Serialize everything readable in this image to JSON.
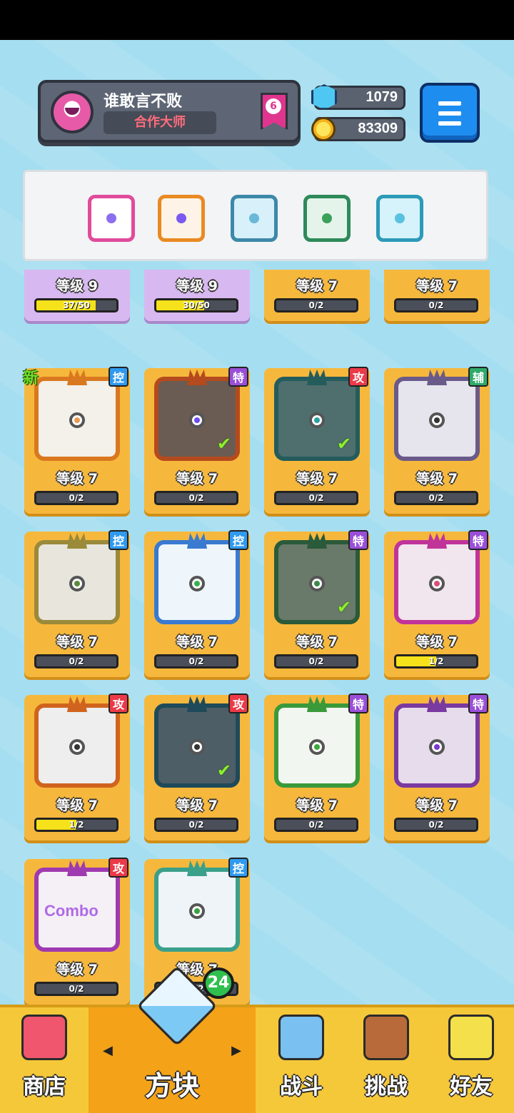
{
  "header": {
    "player_name": "谁敢言不败",
    "player_title": "合作大师",
    "rank": "6",
    "gems": "1079",
    "coins": "83309"
  },
  "deck": [
    {
      "frame": "#e04b9b",
      "inner": "#ffffff",
      "pip": "#8c6ff0"
    },
    {
      "frame": "#e98a22",
      "inner": "#fdf3e6",
      "pip": "#7a5af0"
    },
    {
      "frame": "#3d88a8",
      "inner": "#d8f0fa",
      "pip": "#6ab8d8"
    },
    {
      "frame": "#2e8a5a",
      "inner": "#e4f4ea",
      "pip": "#3aa05a"
    },
    {
      "frame": "#2c9ab8",
      "inner": "#d6f2fa",
      "pip": "#58c2e0"
    }
  ],
  "cards_partial": [
    {
      "level": "等级 9",
      "progress": "37/50",
      "fill": 0.74,
      "purple": true
    },
    {
      "level": "等级 9",
      "progress": "30/50",
      "fill": 0.6,
      "purple": true
    },
    {
      "level": "等级 7",
      "progress": "0/2",
      "fill": 0,
      "purple": false
    },
    {
      "level": "等级 7",
      "progress": "0/2",
      "fill": 0,
      "purple": false
    }
  ],
  "cards": [
    {
      "tag": "控",
      "tagType": "ctrl",
      "level": "等级 7",
      "progress": "0/2",
      "fill": 0,
      "frame": "#d9781f",
      "inner": "#f4f0ea",
      "pip": "#e89a50",
      "new": "新",
      "check": false
    },
    {
      "tag": "特",
      "tagType": "spec",
      "level": "等级 7",
      "progress": "0/2",
      "fill": 0,
      "frame": "#b44a1e",
      "inner": "#6a5c52",
      "pip": "#6d4cf0",
      "check": true
    },
    {
      "tag": "攻",
      "tagType": "atk",
      "level": "等级 7",
      "progress": "0/2",
      "fill": 0,
      "frame": "#245c5c",
      "inner": "#4f6e6e",
      "pip": "#2aa0a0",
      "check": true
    },
    {
      "tag": "辅",
      "tagType": "sup",
      "level": "等级 7",
      "progress": "0/2",
      "fill": 0,
      "frame": "#6a5a8a",
      "inner": "#e6e4ec",
      "pip": "#333333",
      "check": false
    },
    {
      "tag": "控",
      "tagType": "ctrl",
      "level": "等级 7",
      "progress": "0/2",
      "fill": 0,
      "frame": "#9a8a3a",
      "inner": "#e8e6dc",
      "pip": "#5a8a3a",
      "check": false
    },
    {
      "tag": "控",
      "tagType": "ctrl",
      "level": "等级 7",
      "progress": "0/2",
      "fill": 0,
      "frame": "#3a7ad0",
      "inner": "#eef6fc",
      "pip": "#3ab050",
      "check": false
    },
    {
      "tag": "特",
      "tagType": "spec",
      "level": "等级 7",
      "progress": "0/2",
      "fill": 0,
      "frame": "#2a5a3a",
      "inner": "#6a7a6a",
      "pip": "#3a8a4a",
      "check": true
    },
    {
      "tag": "特",
      "tagType": "spec",
      "level": "等级 7",
      "progress": "1/2",
      "fill": 0.5,
      "frame": "#c0349a",
      "inner": "#f2e6ee",
      "pip": "#d8507a",
      "check": false
    },
    {
      "tag": "攻",
      "tagType": "atk",
      "level": "等级 7",
      "progress": "1/2",
      "fill": 0.5,
      "frame": "#d0641e",
      "inner": "#eeeeee",
      "pip": "#333333",
      "check": false
    },
    {
      "tag": "攻",
      "tagType": "atk",
      "level": "等级 7",
      "progress": "0/2",
      "fill": 0,
      "frame": "#1e4a5a",
      "inner": "#4e5e66",
      "pip": "#333333",
      "check": true
    },
    {
      "tag": "特",
      "tagType": "spec",
      "level": "等级 7",
      "progress": "0/2",
      "fill": 0,
      "frame": "#3a9a3a",
      "inner": "#f2f6f0",
      "pip": "#3aaa3a",
      "check": false
    },
    {
      "tag": "特",
      "tagType": "spec",
      "level": "等级 7",
      "progress": "0/2",
      "fill": 0,
      "frame": "#7a3aa0",
      "inner": "#e6dcec",
      "pip": "#7a3ad0",
      "check": false
    },
    {
      "tag": "攻",
      "tagType": "atk",
      "level": "等级 7",
      "progress": "0/2",
      "fill": 0,
      "frame": "#a03ab0",
      "inner": "#f4f0f6",
      "pip": "#c050e0",
      "check": false,
      "combo": "Combo"
    },
    {
      "tag": "控",
      "tagType": "ctrl",
      "level": "等级 7",
      "progress": "0/2",
      "fill": 0,
      "frame": "#3aa08a",
      "inner": "#eef4f8",
      "pip": "#3aa040",
      "check": false
    }
  ],
  "nav": {
    "shop": "商店",
    "blocks": "方块",
    "battle": "战斗",
    "challenge": "挑战",
    "friends": "好友",
    "badge_count": "24"
  },
  "colors": {
    "background": "#a4def0",
    "nav_bar": "#f5c83a",
    "card": "#f6b83c",
    "menu_button": "#1e8df0"
  }
}
